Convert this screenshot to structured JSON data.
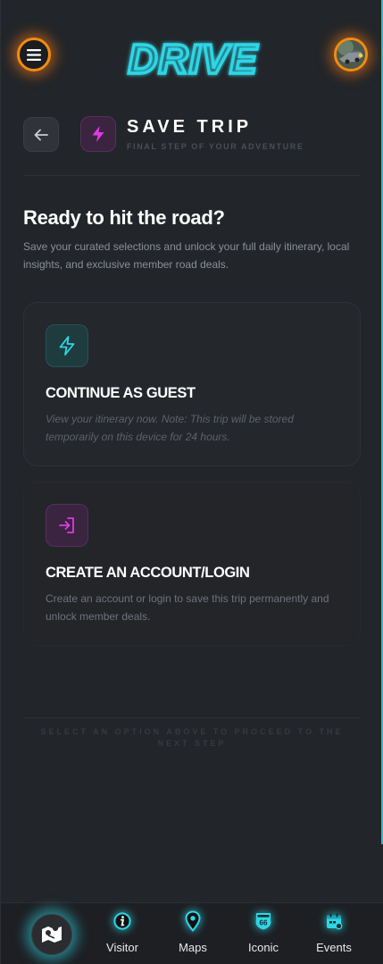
{
  "header": {
    "logo_text": "DRIVE",
    "menu_icon": "hamburger-menu-icon",
    "avatar_icon": "user-avatar"
  },
  "title_section": {
    "title": "SAVE TRIP",
    "subtitle": "FINAL STEP OF YOUR ADVENTURE"
  },
  "main": {
    "heading": "Ready to hit the road?",
    "intro": "Save your curated selections and unlock your full daily itinerary, local insights, and exclusive member road deals."
  },
  "options": [
    {
      "icon": "bolt-icon",
      "title": "CONTINUE AS GUEST",
      "description": "View your itinerary now. Note: This trip will be stored temporarily on this device for 24 hours."
    },
    {
      "icon": "login-icon",
      "title": "CREATE AN ACCOUNT/LOGIN",
      "description": "Create an account or login to save this trip permanently and unlock member deals."
    }
  ],
  "footer_note": "SELECT AN OPTION ABOVE TO PROCEED TO THE NEXT STEP",
  "bottom_nav": {
    "items": [
      {
        "label": "Visitor",
        "icon": "info-icon"
      },
      {
        "label": "Maps",
        "icon": "map-pin-icon"
      },
      {
        "label": "Iconic",
        "icon": "route-66-icon"
      },
      {
        "label": "Events",
        "icon": "calendar-icon"
      }
    ]
  },
  "colors": {
    "accent_cyan": "#2fd6e6",
    "accent_orange": "#f28c13",
    "accent_magenta": "#d43ad8",
    "background": "#222529"
  }
}
